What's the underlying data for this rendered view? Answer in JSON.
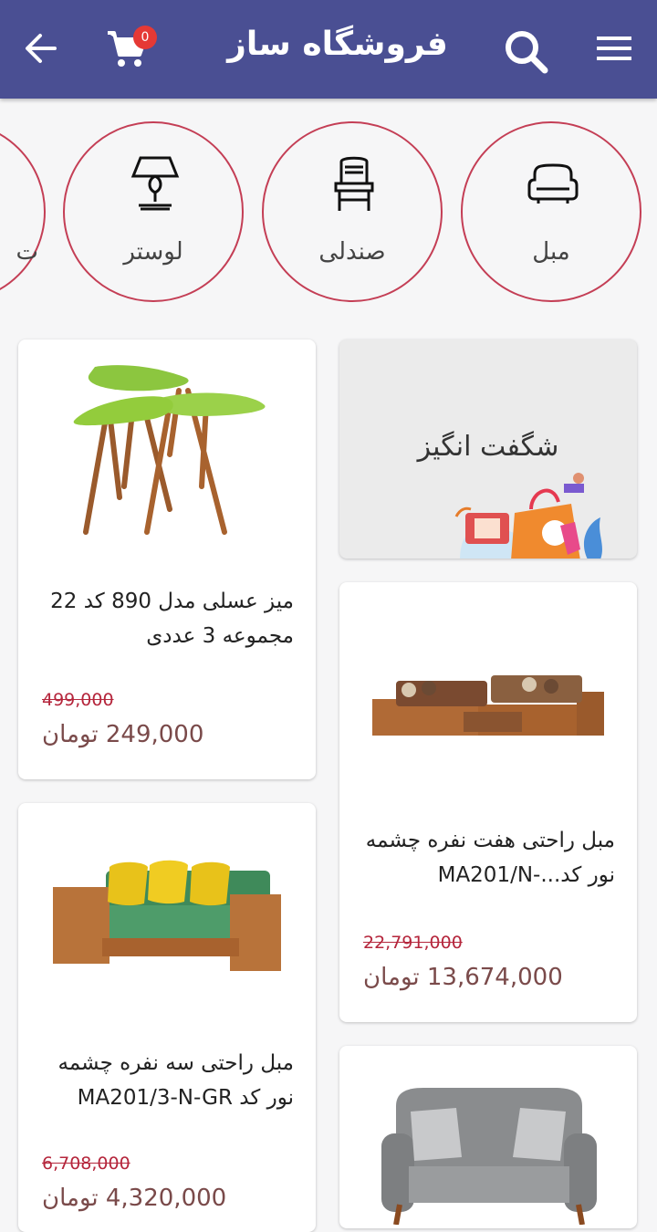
{
  "header": {
    "title": "فروشگاه ساز",
    "cart_count": "0",
    "icons": [
      "menu-icon",
      "search-icon",
      "cart-icon",
      "back-arrow-icon"
    ],
    "bg_color": "#4a4f93"
  },
  "categories": [
    {
      "label": "مبل",
      "icon": "sofa-icon"
    },
    {
      "label": "صندلی",
      "icon": "chair-icon"
    },
    {
      "label": "لوستر",
      "icon": "lamp-icon"
    },
    {
      "label": "ت",
      "icon": ""
    }
  ],
  "promo": {
    "title": "شگفت انگیز"
  },
  "products": [
    {
      "name": "میز عسلی مدل 890 کد 22 مجموعه 3 عددی",
      "old_price": "499,000",
      "new_price": "249,000 تومان"
    },
    {
      "name": "مبل راحتی هفت نفره چشمه نور کد...-MA201/N",
      "old_price": "22,791,000",
      "new_price": "13,674,000 تومان"
    },
    {
      "name": "مبل راحتی سه نفره چشمه نور کد MA201/3-N-GR",
      "old_price": "6,708,000",
      "new_price": "4,320,000 تومان"
    }
  ],
  "colors": {
    "accent": "#c43e55",
    "old_price": "#b5263c",
    "price": "#7a4a4a"
  }
}
